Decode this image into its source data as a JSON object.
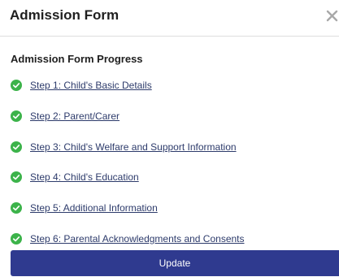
{
  "modal": {
    "title": "Admission Form",
    "close_icon": "close-icon"
  },
  "progress": {
    "title": "Admission Form Progress",
    "steps": [
      {
        "label": "Step 1: Child's Basic Details",
        "complete": true
      },
      {
        "label": "Step 2: Parent/Carer",
        "complete": true
      },
      {
        "label": "Step 3: Child's Welfare and Support Information",
        "complete": true
      },
      {
        "label": "Step 4: Child's Education",
        "complete": true
      },
      {
        "label": "Step 5: Additional Information",
        "complete": true
      },
      {
        "label": "Step 6: Parental Acknowledgments and Consents",
        "complete": true
      }
    ]
  },
  "actions": {
    "update_label": "Update"
  },
  "colors": {
    "check": "#3cb34a",
    "link": "#2d3b6b",
    "button": "#2f3a8f"
  }
}
